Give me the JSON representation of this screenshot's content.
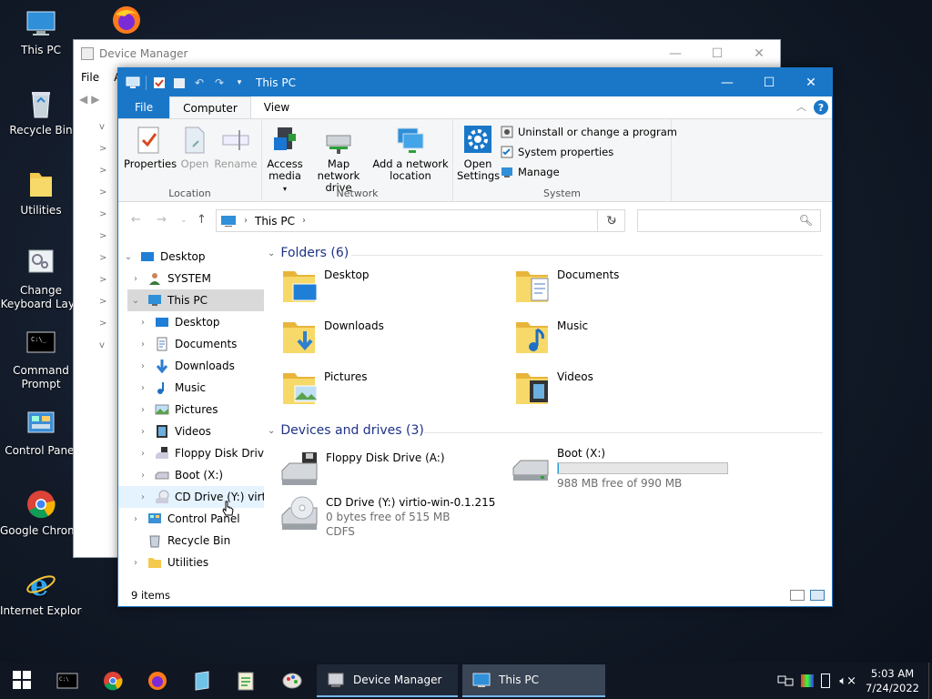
{
  "desktop": {
    "icons": [
      {
        "label": "This PC"
      },
      {
        "label": "Recycle Bin"
      },
      {
        "label": "Utilities"
      },
      {
        "label": "Change Keyboard Layo"
      },
      {
        "label": "Command Prompt"
      },
      {
        "label": "Control Panel"
      },
      {
        "label": "Google Chrome"
      },
      {
        "label": "Internet Explorer"
      }
    ]
  },
  "device_manager": {
    "title": "Device Manager",
    "menu": [
      "File",
      "A"
    ]
  },
  "explorer": {
    "title": "This PC",
    "tabs": {
      "file": "File",
      "computer": "Computer",
      "view": "View"
    },
    "help": "?",
    "ribbon": {
      "location": {
        "group": "Location",
        "properties": "Properties",
        "open": "Open",
        "rename": "Rename"
      },
      "network": {
        "group": "Network",
        "access_media": "Access media",
        "map_drive": "Map network drive",
        "add_location": "Add a network location"
      },
      "system": {
        "group": "System",
        "open_settings": "Open Settings",
        "uninstall": "Uninstall or change a program",
        "system_properties": "System properties",
        "manage": "Manage"
      }
    },
    "address": {
      "path": "This PC",
      "search_placeholder": ""
    },
    "nav": [
      {
        "label": "Desktop",
        "level": 0,
        "chev": "v",
        "icon": "desktop"
      },
      {
        "label": "SYSTEM",
        "level": 1,
        "chev": ">",
        "icon": "user"
      },
      {
        "label": "This PC",
        "level": 1,
        "chev": "v",
        "icon": "pc",
        "selected": true
      },
      {
        "label": "Desktop",
        "level": 2,
        "chev": ">",
        "icon": "desktop"
      },
      {
        "label": "Documents",
        "level": 2,
        "chev": ">",
        "icon": "docs"
      },
      {
        "label": "Downloads",
        "level": 2,
        "chev": ">",
        "icon": "down"
      },
      {
        "label": "Music",
        "level": 2,
        "chev": ">",
        "icon": "music"
      },
      {
        "label": "Pictures",
        "level": 2,
        "chev": ">",
        "icon": "pics"
      },
      {
        "label": "Videos",
        "level": 2,
        "chev": ">",
        "icon": "vids"
      },
      {
        "label": "Floppy Disk Drive",
        "level": 2,
        "chev": ">",
        "icon": "floppy"
      },
      {
        "label": "Boot (X:)",
        "level": 2,
        "chev": ">",
        "icon": "hdd"
      },
      {
        "label": "CD Drive (Y:) virtic",
        "level": 2,
        "chev": ">",
        "icon": "cd",
        "hover": true
      },
      {
        "label": "Control Panel",
        "level": 1,
        "chev": ">",
        "icon": "cpanel"
      },
      {
        "label": "Recycle Bin",
        "level": 1,
        "chev": "",
        "icon": "bin"
      },
      {
        "label": "Utilities",
        "level": 1,
        "chev": ">",
        "icon": "folder"
      }
    ],
    "folders_header": "Folders (6)",
    "folders": [
      {
        "label": "Desktop",
        "icon": "desktop"
      },
      {
        "label": "Documents",
        "icon": "docs"
      },
      {
        "label": "Downloads",
        "icon": "down"
      },
      {
        "label": "Music",
        "icon": "music"
      },
      {
        "label": "Pictures",
        "icon": "pics"
      },
      {
        "label": "Videos",
        "icon": "vids"
      }
    ],
    "drives_header": "Devices and drives (3)",
    "drives": {
      "floppy": {
        "name": "Floppy Disk Drive (A:)"
      },
      "boot": {
        "name": "Boot (X:)",
        "free": "988 MB free of 990 MB",
        "used_fraction": 0.002
      },
      "cd": {
        "name": "CD Drive (Y:) virtio-win-0.1.215",
        "free": "0 bytes free of 515 MB",
        "fs": "CDFS"
      }
    },
    "status": "9 items"
  },
  "taskbar": {
    "apps": [
      {
        "label": "Device Manager"
      },
      {
        "label": "This PC"
      }
    ],
    "time": "5:03 AM",
    "date": "7/24/2022"
  },
  "colors": {
    "accent": "#1a77c8",
    "folder": "#f3c94e",
    "header_text": "#1e3287"
  }
}
